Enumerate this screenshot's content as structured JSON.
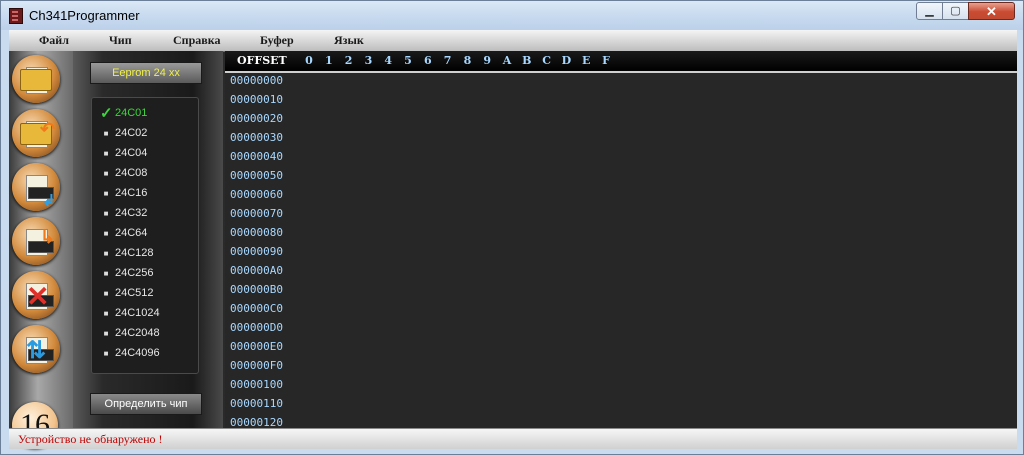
{
  "window": {
    "title": "Ch341Programmer",
    "min_label": "▁",
    "max_label": "▢",
    "close_label": "✕"
  },
  "menu": [
    "Файл",
    "Чип",
    "Справка",
    "Буфер",
    "Язык"
  ],
  "toolbar": {
    "buttons": [
      "open-file-icon",
      "save-file-icon",
      "read-chip-icon",
      "write-chip-icon",
      "erase-chip-icon",
      "verify-chip-icon"
    ],
    "bus_width": "16"
  },
  "chip_panel": {
    "family_button": "Eeprom 24 xx",
    "chips": [
      "24C01",
      "24C02",
      "24C04",
      "24C08",
      "24C16",
      "24C32",
      "24C64",
      "24C128",
      "24C256",
      "24C512",
      "24C1024",
      "24C2048",
      "24C4096"
    ],
    "selected": "24C01",
    "check_mark": "✓",
    "bullet": "■",
    "detect_button": "Определить чип"
  },
  "hex": {
    "offset_label": "OFFSET",
    "columns": [
      "0",
      "1",
      "2",
      "3",
      "4",
      "5",
      "6",
      "7",
      "8",
      "9",
      "A",
      "B",
      "C",
      "D",
      "E",
      "F"
    ],
    "rows": [
      "00000000",
      "00000010",
      "00000020",
      "00000030",
      "00000040",
      "00000050",
      "00000060",
      "00000070",
      "00000080",
      "00000090",
      "000000A0",
      "000000B0",
      "000000C0",
      "000000D0",
      "000000E0",
      "000000F0",
      "00000100",
      "00000110",
      "00000120"
    ]
  },
  "status": {
    "text": "Устройство не обнаружено !",
    "color": "#c00000"
  }
}
